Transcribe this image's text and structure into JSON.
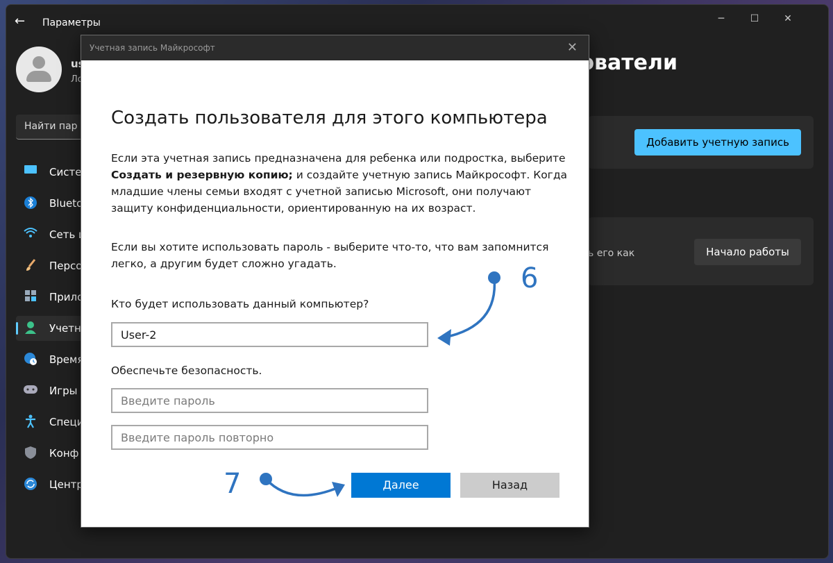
{
  "window": {
    "title": "Параметры",
    "user_name": "us",
    "user_sub": "Ло",
    "search_text": "Найти пар",
    "page_heading": "ьзователи"
  },
  "sidebar": {
    "items": [
      {
        "label": "Систе",
        "icon": "monitor-icon"
      },
      {
        "label": "Blueto",
        "icon": "bluetooth-icon"
      },
      {
        "label": "Сеть и",
        "icon": "wifi-icon"
      },
      {
        "label": "Персо",
        "icon": "brush-icon"
      },
      {
        "label": "Прило",
        "icon": "apps-icon"
      },
      {
        "label": "Учетн",
        "icon": "person-icon",
        "active": true
      },
      {
        "label": "Время",
        "icon": "globe-clock-icon"
      },
      {
        "label": "Игры",
        "icon": "gamepad-icon"
      },
      {
        "label": "Специ",
        "icon": "accessibility-icon"
      },
      {
        "label": "Конф",
        "icon": "shield-icon"
      },
      {
        "label": "Центр",
        "icon": "update-icon"
      }
    ]
  },
  "background_cards": {
    "add_account_label": "Добавить учетную запись",
    "start_label": "Начало работы",
    "card_text": "ь его как"
  },
  "dialog": {
    "title": "Учетная запись Майкрософт",
    "heading": "Создать пользователя для этого компьютера",
    "para1_a": "Если эта учетная запись предназначена для ребенка или подростка, выберите",
    "para1_bold": "Создать и резервную копию;",
    "para1_b": " и создайте учетную запись Майкрософт. Когда младшие члены семьи входят с учетной записью Microsoft, они получают защиту конфиденциальности, ориентированную на их возраст.",
    "para2": "Если вы хотите использовать пароль - выберите что-то, что вам запомнится легко, а другим будет сложно угадать.",
    "username_label": "Кто будет использовать данный компьютер?",
    "username_value": "User-2",
    "security_label": "Обеспечьте безопасность.",
    "password_placeholder": "Введите пароль",
    "password_repeat_placeholder": "Введите пароль повторно",
    "next_label": "Далее",
    "back_label": "Назад"
  },
  "annotations": {
    "step6": "6",
    "step7": "7",
    "color": "#2f74c0"
  }
}
